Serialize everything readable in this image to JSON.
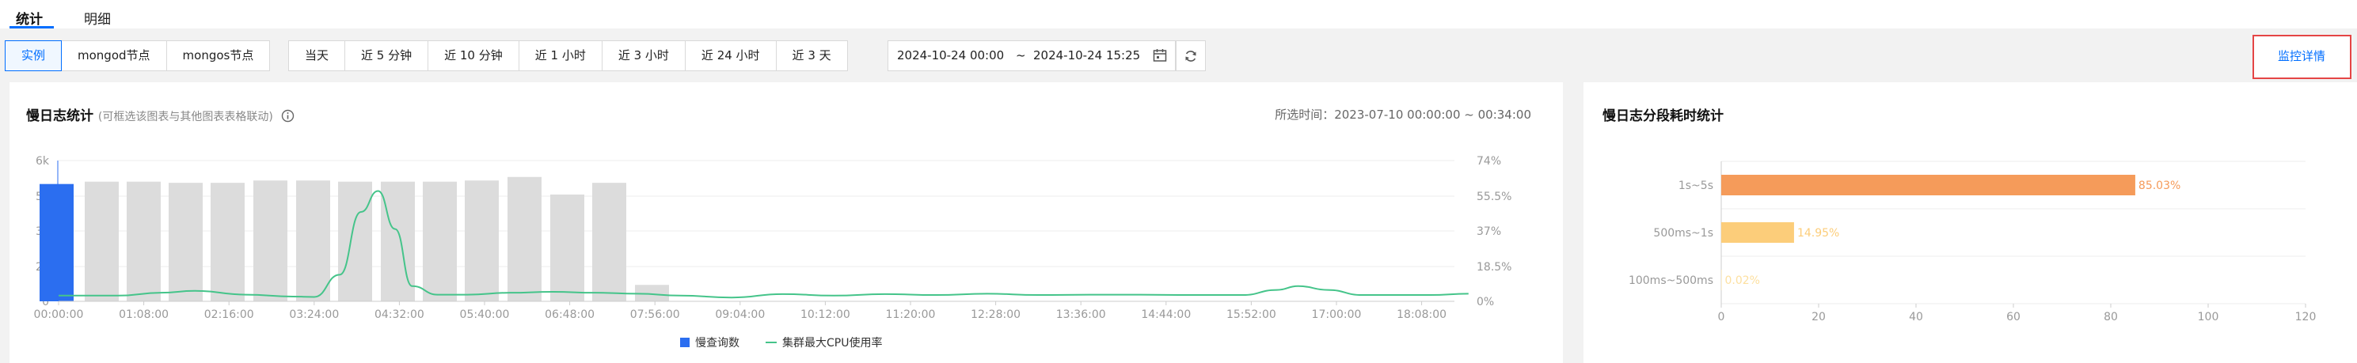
{
  "tabs": [
    {
      "label": "统计",
      "active": true
    },
    {
      "label": "明细",
      "active": false
    }
  ],
  "node_filter": [
    "实例",
    "mongod节点",
    "mongos节点"
  ],
  "time_presets": [
    "当天",
    "近 5 分钟",
    "近 10 分钟",
    "近 1 小时",
    "近 3 小时",
    "近 24 小时",
    "近 3 天"
  ],
  "date_range": {
    "start": "2024-10-24 00:00",
    "separator": "~",
    "end": "2024-10-24 15:25"
  },
  "monitor_button": "监控详情",
  "left_panel": {
    "title": "慢日志统计",
    "subtitle": "(可框选该图表与其他图表表格联动)",
    "selected_time": "所选时间：2023-07-10 00:00:00 ~ 00:34:00"
  },
  "right_panel": {
    "title": "慢日志分段耗时统计"
  },
  "colors": {
    "accent": "#006eff",
    "bar_selected": "#2b6ef0",
    "bar_gray": "#dcdcdc",
    "cpu_line": "#45c48a",
    "highlight_border": "#e54545"
  },
  "chart_data": [
    {
      "type": "bar",
      "x_ticks": [
        "00:00:00",
        "01:08:00",
        "02:16:00",
        "03:24:00",
        "04:32:00",
        "05:40:00",
        "06:48:00",
        "07:56:00",
        "09:04:00",
        "10:12:00",
        "11:20:00",
        "12:28:00",
        "13:36:00",
        "14:44:00",
        "15:52:00",
        "17:00:00",
        "18:08:00"
      ],
      "y_ticks": [
        "0",
        "2k",
        "3k",
        "5k",
        "6k"
      ],
      "y_right_ticks": [
        "0%",
        "18.5%",
        "37%",
        "55.5%",
        "74%"
      ],
      "ylim": [
        0,
        6000
      ],
      "y_right_lim": [
        0,
        74
      ],
      "grid": true,
      "legend_position": "bottom",
      "series": [
        {
          "name": "慢查询数",
          "type": "bar",
          "values": [
            5000,
            5100,
            5100,
            5050,
            5050,
            5150,
            5150,
            5100,
            5100,
            5100,
            5150,
            5300,
            4550,
            5050,
            700
          ],
          "selected_index": 0
        },
        {
          "name": "集群最大CPU使用率",
          "type": "line",
          "x": [
            0,
            0.7,
            1.2,
            1.6,
            2.2,
            2.75,
            3.0,
            3.3,
            3.55,
            3.75,
            3.95,
            4.15,
            4.45,
            4.8,
            5.3,
            5.8,
            6.3,
            6.8,
            7.3,
            7.9,
            8.5,
            9.1,
            9.7,
            10.3,
            10.9,
            11.5,
            12.1,
            12.7,
            13.3,
            13.9,
            14.3,
            14.55,
            14.9,
            15.3,
            15.7,
            16.1,
            16.55
          ],
          "y": [
            3,
            3,
            4.5,
            5.5,
            3.5,
            2.5,
            2.3,
            14,
            47,
            58,
            38,
            8,
            3.5,
            3.5,
            4.5,
            5,
            4.5,
            4,
            3,
            2,
            3.8,
            3,
            3.8,
            3.3,
            4,
            3.3,
            3.5,
            3.5,
            3.3,
            3.3,
            6,
            8,
            6,
            3.3,
            3.3,
            3.3,
            4
          ]
        }
      ]
    },
    {
      "type": "bar",
      "orientation": "horizontal",
      "categories": [
        "1s~5s",
        "500ms~1s",
        "100ms~500ms"
      ],
      "values": [
        85.03,
        14.95,
        0.02
      ],
      "labels": [
        "85.03%",
        "14.95%",
        "0.02%"
      ],
      "colors": [
        "#f59b5a",
        "#fccd7a",
        "#fde0a0"
      ],
      "x_ticks": [
        "0",
        "20",
        "40",
        "60",
        "80",
        "100",
        "120"
      ],
      "xlim": [
        0,
        120
      ]
    }
  ]
}
